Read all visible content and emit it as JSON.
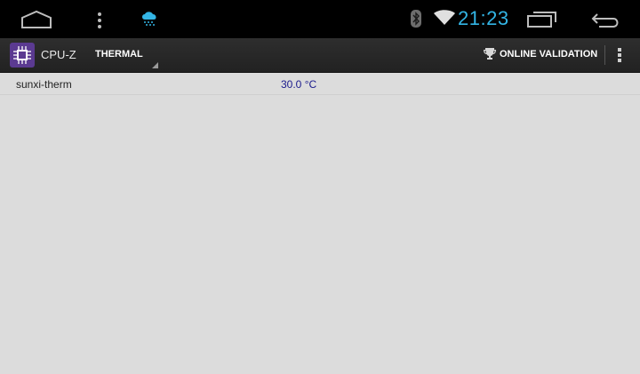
{
  "status_bar": {
    "time": "21:23",
    "icons": [
      "home-icon",
      "menu-dots-icon",
      "weather-snow-icon",
      "bluetooth-icon",
      "wifi-icon",
      "recent-apps-icon",
      "back-icon"
    ],
    "accent_color": "#33b5e5"
  },
  "action_bar": {
    "app_name": "CPU-Z",
    "tab": "THERMAL",
    "online_validation": "ONLINE VALIDATION",
    "icons": [
      "cpu-z-logo-icon",
      "trophy-icon",
      "overflow-menu-icon"
    ]
  },
  "thermal": {
    "rows": [
      {
        "label": "sunxi-therm",
        "value": "30.0 °C"
      }
    ]
  }
}
